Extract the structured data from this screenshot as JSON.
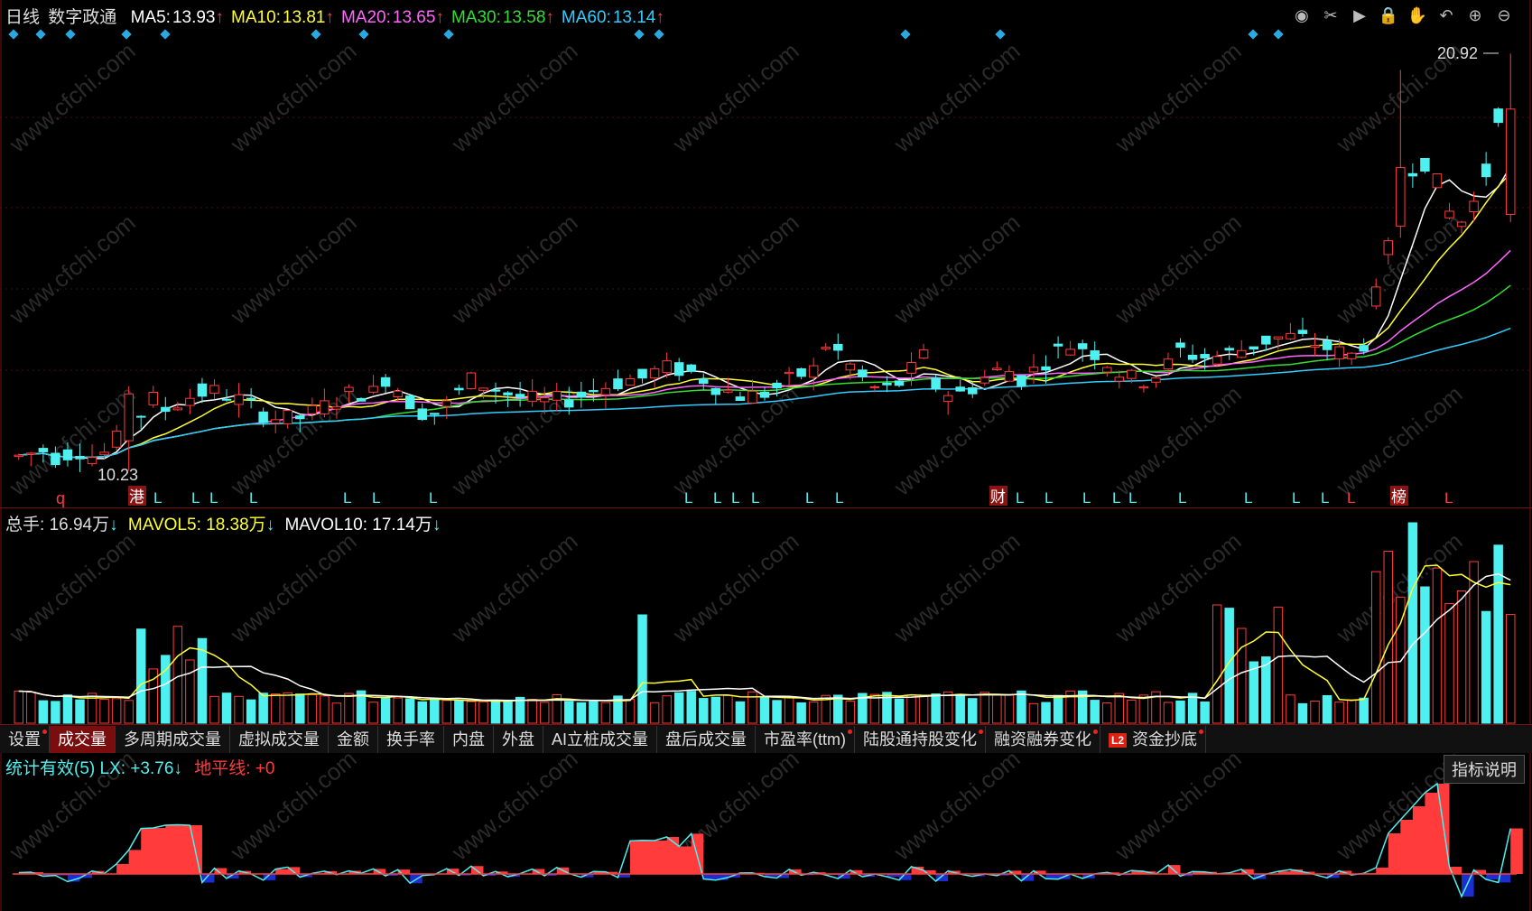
{
  "header": {
    "period": "日线",
    "stock_name": "数字政通",
    "ma": [
      {
        "label": "MA5:",
        "value": "13.93",
        "arrow": "↑",
        "color": "#ffffff"
      },
      {
        "label": "MA10:",
        "value": "13.81",
        "arrow": "↑",
        "color": "#ffff33"
      },
      {
        "label": "MA20:",
        "value": "13.65",
        "arrow": "↑",
        "color": "#ff66ff"
      },
      {
        "label": "MA30:",
        "value": "13.58",
        "arrow": "↑",
        "color": "#33dd33"
      },
      {
        "label": "MA60:",
        "value": "13.14",
        "arrow": "↑",
        "color": "#33ccff"
      }
    ]
  },
  "toolbar": {
    "icons": [
      "eye-icon",
      "scissors-icon",
      "play-icon",
      "lock-icon",
      "hand-icon",
      "undo-icon",
      "zoom-in-icon",
      "zoom-out-icon"
    ],
    "glyphs": [
      "◉",
      "✂",
      "▶",
      "🔒",
      "✋",
      "↶",
      "⊕",
      "⊖"
    ]
  },
  "price_chart": {
    "high_label": "20.92",
    "low_label": "10.23",
    "marker_gang": "港",
    "marker_cai": "财",
    "marker_bang": "榜",
    "marker_q": "q",
    "l_marker": "L"
  },
  "volume_header": {
    "total_label": "总手:",
    "total_value": "16.94万",
    "total_arrow": "↓",
    "mavol5_label": "MAVOL5:",
    "mavol5_value": "18.38万",
    "mavol5_arrow": "↓",
    "mavol10_label": "MAVOL10:",
    "mavol10_value": "17.14万",
    "mavol10_arrow": "↓"
  },
  "tabs": [
    {
      "label": "设置",
      "dot": true,
      "l2": false
    },
    {
      "label": "成交量",
      "dot": false,
      "active": true,
      "l2": false
    },
    {
      "label": "多周期成交量",
      "dot": false,
      "l2": false
    },
    {
      "label": "虚拟成交量",
      "dot": false,
      "l2": false
    },
    {
      "label": "金额",
      "dot": false,
      "l2": false
    },
    {
      "label": "换手率",
      "dot": false,
      "l2": false
    },
    {
      "label": "内盘",
      "dot": false,
      "l2": false
    },
    {
      "label": "外盘",
      "dot": false,
      "l2": false
    },
    {
      "label": "AI立桩成交量",
      "dot": false,
      "l2": false
    },
    {
      "label": "盘后成交量",
      "dot": false,
      "l2": false
    },
    {
      "label": "市盈率(ttm)",
      "dot": true,
      "l2": false
    },
    {
      "label": "陆股通持股变化",
      "dot": true,
      "l2": false
    },
    {
      "label": "融资融券变化",
      "dot": true,
      "l2": false
    },
    {
      "label": "资金抄底",
      "dot": true,
      "l2": true
    }
  ],
  "indicator": {
    "name": "统计有效(5)",
    "lx_label": "LX:",
    "lx_value": "+3.76",
    "lx_arrow": "↓",
    "base_label": "地平线:",
    "base_value": "+0",
    "help_button": "指标说明"
  },
  "watermark": "www.cfchi.com",
  "colors": {
    "up": "#ff3b3b",
    "down": "#4ef0f0",
    "grid": "#7a1010",
    "diamond": "#2aa8e0"
  }
}
